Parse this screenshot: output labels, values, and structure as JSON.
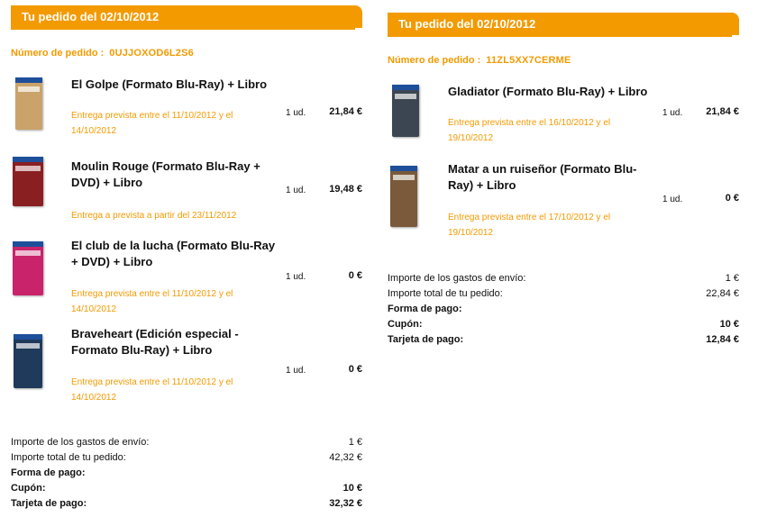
{
  "orders": [
    {
      "header": "Tu pedido del 02/10/2012",
      "order_number_label": "Número de pedido  :",
      "order_number": "0UJJOXOD6L2S6",
      "items": [
        {
          "name": "El Golpe (Formato Blu-Ray) + Libro",
          "delivery": "Entrega prevista entre el 11/10/2012 y el 14/10/2012",
          "qty": "1 ud.",
          "price": "21,84 €",
          "cover_color": "#c9a36a"
        },
        {
          "name": "Moulin Rouge (Formato Blu-Ray + DVD) + Libro",
          "delivery": "Entrega a prevista a partir del 23/11/2012",
          "qty": "1 ud.",
          "price": "19,48 €",
          "cover_color": "#8a1f22"
        },
        {
          "name": "El club de la lucha (Formato Blu-Ray + DVD) + Libro",
          "delivery": "Entrega prevista entre el 11/10/2012 y el 14/10/2012",
          "qty": "1 ud.",
          "price": "0 €",
          "cover_color": "#c8236b"
        },
        {
          "name": "Braveheart (Edición especial - Formato Blu-Ray) + Libro",
          "delivery": "Entrega prevista entre el 11/10/2012 y el 14/10/2012",
          "qty": "1 ud.",
          "price": "0 €",
          "cover_color": "#1f3a5a"
        }
      ],
      "summary": [
        {
          "label": "Importe de los gastos de envío:",
          "value": "1 €",
          "bold": false
        },
        {
          "label": "Importe total de tu pedido:",
          "value": "42,32 €",
          "bold": false
        },
        {
          "label": "Forma de pago:",
          "value": "",
          "bold": true
        },
        {
          "label": "Cupón:",
          "value": "10 €",
          "bold": true
        },
        {
          "label": "Tarjeta de pago:",
          "value": "32,32 €",
          "bold": true
        }
      ]
    },
    {
      "header": "Tu pedido del 02/10/2012",
      "order_number_label": "Número de pedido  :",
      "order_number": "11ZL5XX7CERME",
      "items": [
        {
          "name": "Gladiator (Formato Blu-Ray) + Libro",
          "delivery": "Entrega prevista entre el 16/10/2012 y el 19/10/2012",
          "qty": "1 ud.",
          "price": "21,84 €",
          "cover_color": "#3b4652"
        },
        {
          "name": "Matar a un ruiseñor (Formato Blu-Ray) + Libro",
          "delivery": "Entrega prevista entre el 17/10/2012 y el 19/10/2012",
          "qty": "1 ud.",
          "price": "0 €",
          "cover_color": "#7a5a3a"
        }
      ],
      "summary": [
        {
          "label": "Importe de los gastos de envío:",
          "value": "1 €",
          "bold": false
        },
        {
          "label": "Importe total de tu pedido:",
          "value": "22,84 €",
          "bold": false
        },
        {
          "label": "Forma de pago:",
          "value": "",
          "bold": true
        },
        {
          "label": "Cupón:",
          "value": "10 €",
          "bold": true
        },
        {
          "label": "Tarjeta de pago:",
          "value": "12,84 €",
          "bold": true
        }
      ]
    }
  ]
}
